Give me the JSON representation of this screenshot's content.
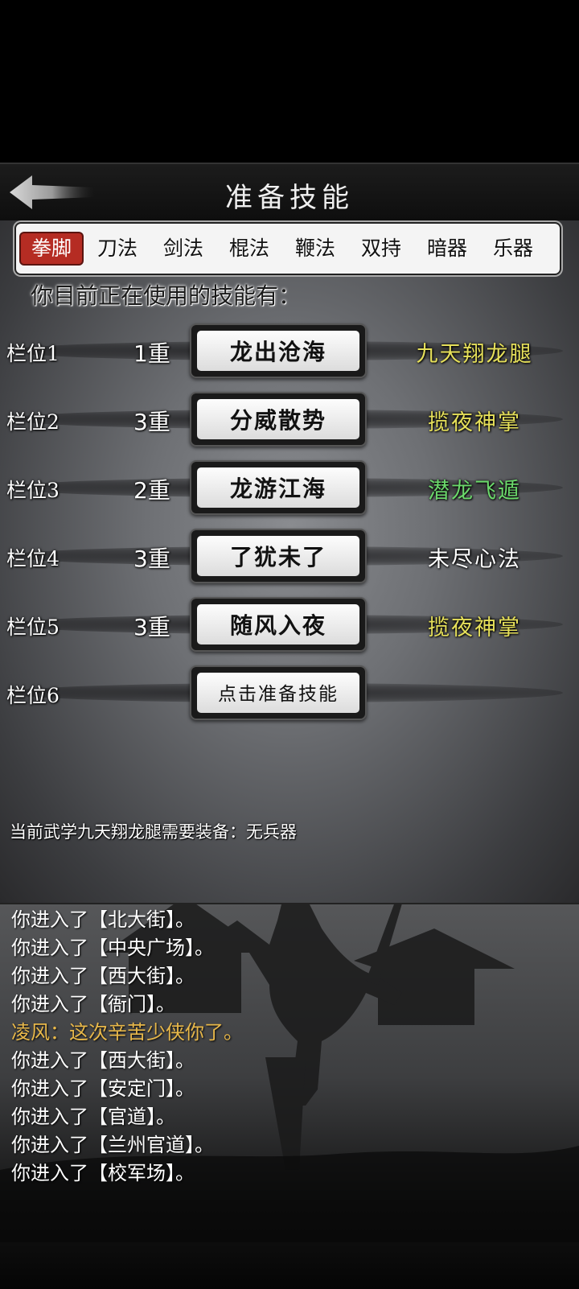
{
  "header": {
    "title": "准备技能"
  },
  "tabs": [
    {
      "label": "拳脚",
      "active": true
    },
    {
      "label": "刀法",
      "active": false
    },
    {
      "label": "剑法",
      "active": false
    },
    {
      "label": "棍法",
      "active": false
    },
    {
      "label": "鞭法",
      "active": false
    },
    {
      "label": "双持",
      "active": false
    },
    {
      "label": "暗器",
      "active": false
    },
    {
      "label": "乐器",
      "active": false
    }
  ],
  "intro_text": "你目前正在使用的技能有：",
  "slots": [
    {
      "label": "栏位1",
      "level": "1重",
      "skill": "龙出沧海",
      "source": "九天翔龙腿",
      "source_color": "#e6e05a"
    },
    {
      "label": "栏位2",
      "level": "3重",
      "skill": "分威散势",
      "source": "揽夜神掌",
      "source_color": "#e6e05a"
    },
    {
      "label": "栏位3",
      "level": "2重",
      "skill": "龙游江海",
      "source": "潜龙飞遁",
      "source_color": "#6bd86b"
    },
    {
      "label": "栏位4",
      "level": "3重",
      "skill": "了犹未了",
      "source": "未尽心法",
      "source_color": "#ffffff"
    },
    {
      "label": "栏位5",
      "level": "3重",
      "skill": "随风入夜",
      "source": "揽夜神掌",
      "source_color": "#e6e05a"
    },
    {
      "label": "栏位6",
      "level": "",
      "skill": "点击准备技能",
      "source": "",
      "source_color": "#ffffff"
    }
  ],
  "equip_note": "当前武学九天翔龙腿需要装备：无兵器",
  "log": [
    {
      "text": "你进入了【北大街】。",
      "color": "#ffffff"
    },
    {
      "text": "你进入了【中央广场】。",
      "color": "#ffffff"
    },
    {
      "text": "你进入了【西大街】。",
      "color": "#ffffff"
    },
    {
      "text": "你进入了【衙门】。",
      "color": "#ffffff"
    },
    {
      "text": "凌风：这次辛苦少侠你了。",
      "color": "#e8b84a"
    },
    {
      "text": "你进入了【西大街】。",
      "color": "#ffffff"
    },
    {
      "text": "你进入了【安定门】。",
      "color": "#ffffff"
    },
    {
      "text": "你进入了【官道】。",
      "color": "#ffffff"
    },
    {
      "text": "你进入了【兰州官道】。",
      "color": "#ffffff"
    },
    {
      "text": "你进入了【校军场】。",
      "color": "#ffffff"
    }
  ]
}
